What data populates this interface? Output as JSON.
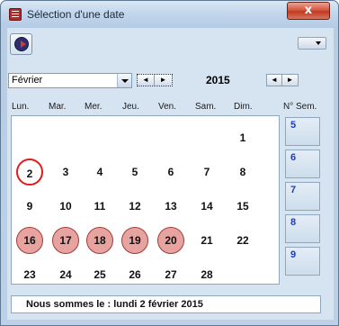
{
  "window": {
    "title": "Sélection d'une date",
    "close_label": "x"
  },
  "toolbar": {
    "app_icon": "calendar-app-icon",
    "menu_icon": "dropdown-caret-icon"
  },
  "month_select": {
    "value": "Février"
  },
  "year": "2015",
  "spin_left": "◄",
  "spin_right": "►",
  "weekdays": [
    "Lun.",
    "Mar.",
    "Mer.",
    "Jeu.",
    "Ven.",
    "Sam.",
    "Dim."
  ],
  "week_header": "N° Sem.",
  "weeks": [
    {
      "number": "5",
      "days": [
        "",
        "",
        "",
        "",
        "",
        "",
        "1"
      ]
    },
    {
      "number": "6",
      "days": [
        "2",
        "3",
        "4",
        "5",
        "6",
        "7",
        "8"
      ]
    },
    {
      "number": "7",
      "days": [
        "9",
        "10",
        "11",
        "12",
        "13",
        "14",
        "15"
      ]
    },
    {
      "number": "8",
      "days": [
        "16",
        "17",
        "18",
        "19",
        "20",
        "21",
        "22"
      ]
    },
    {
      "number": "9",
      "days": [
        "23",
        "24",
        "25",
        "26",
        "27",
        "28",
        ""
      ]
    }
  ],
  "today": "2",
  "marked_days": [
    "16",
    "17",
    "18",
    "19",
    "20"
  ],
  "status": "Nous sommes le : lundi 2 février 2015",
  "colors": {
    "today_ring": "#e01b1b",
    "marked_fill": "#e7a3a0",
    "week_number": "#1a3bd0"
  }
}
